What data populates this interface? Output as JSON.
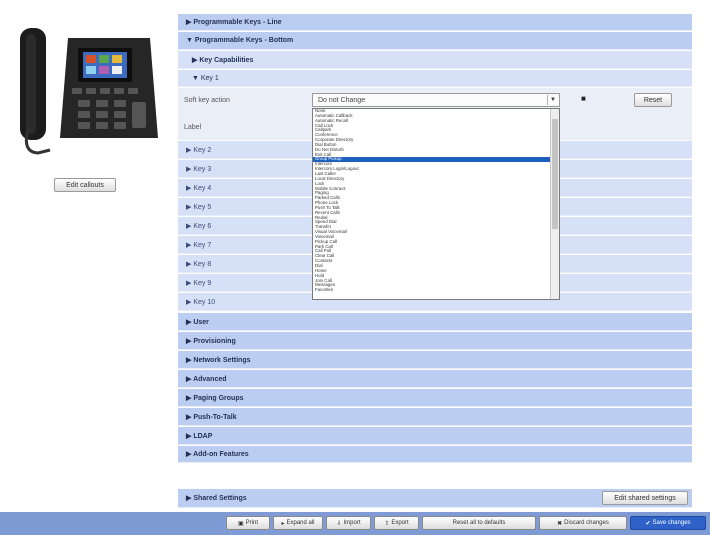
{
  "phone": {
    "image": "desk-phone-image"
  },
  "edit_callouts_label": "Edit callouts",
  "sections_top": [
    "▶ Programmable Keys - Line",
    "▼ Programmable Keys - Bottom"
  ],
  "key_capabilities": "▶ Key Capabilities",
  "key1": "▼ Key 1",
  "key1_form": {
    "soft_key_action_label": "Soft key action",
    "selected_value": "Do not Change",
    "label_label": "Label",
    "reset_label": "Reset"
  },
  "dropdown_options": [
    "None",
    "Automatic Callback",
    "Automatic Recall",
    "Call Lock",
    "Callpark",
    "Conference",
    "Corporate Directory",
    "Dial Button",
    "Do Not Disturb",
    "Exit Call",
    "Group Pickup",
    "Intercom",
    "Intercom Login/Logout",
    "Last Caller",
    "Local Directory",
    "Lock",
    "Mobile Connect",
    "Paging",
    "Parked Calls",
    "Phone Lock",
    "Push To Talk",
    "Recent Calls",
    "Redial",
    "Speed Dial",
    "Transfer",
    "Visual Voicemail",
    "Voicemail",
    "Pickup Call",
    "Park Call",
    "Call Pull",
    "Clear Call",
    "Contacts",
    "Dial",
    "Home",
    "Hold",
    "Join Call",
    "Messages",
    "Favorites"
  ],
  "selected_option_index": 10,
  "keys": [
    "▶ Key 2",
    "▶ Key 3",
    "▶ Key 4",
    "▶ Key 5",
    "▶ Key 6",
    "▶ Key 7",
    "▶ Key 8",
    "▶ Key 9",
    "▶ Key 10"
  ],
  "sections": [
    "▶ User",
    "▶ Provisioning",
    "▶ Network Settings",
    "▶ Advanced",
    "▶ Paging Groups",
    "▶ Push-To-Talk",
    "▶ LDAP",
    "▶ Add-on Features"
  ],
  "shared_settings": {
    "label": "▶ Shared Settings",
    "edit_button": "Edit shared settings"
  },
  "toolbar": {
    "print": "Print",
    "expand_all": "Expand all",
    "import": "Import",
    "export": "Export",
    "reset_all": "Reset all to defaults",
    "discard": "Discard changes",
    "save": "Save changes"
  }
}
